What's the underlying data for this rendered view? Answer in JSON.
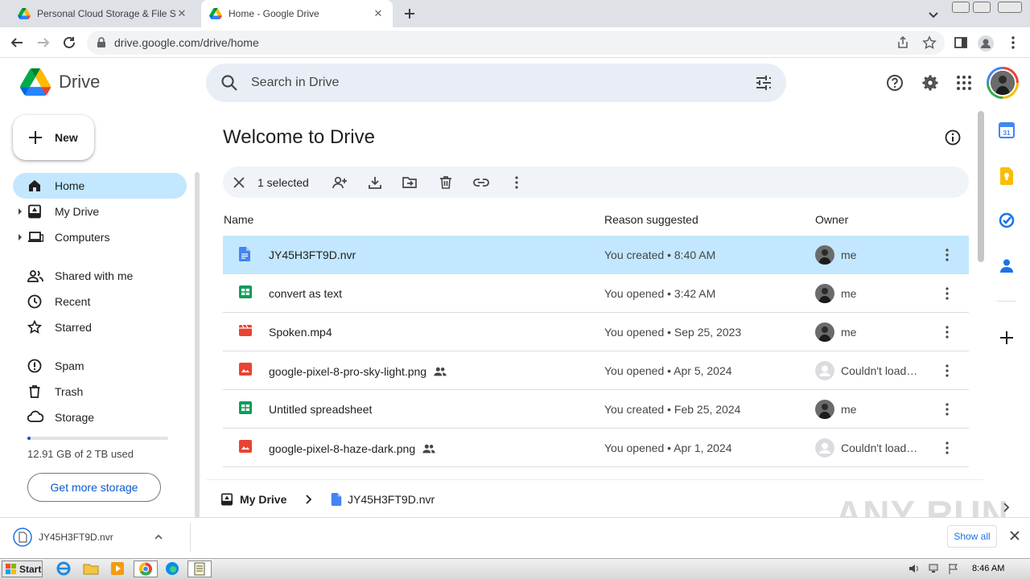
{
  "browser": {
    "tabs": [
      {
        "title": "Personal Cloud Storage & File Sharing",
        "active": false
      },
      {
        "title": "Home - Google Drive",
        "active": true
      }
    ],
    "url": "drive.google.com/drive/home"
  },
  "header": {
    "app_name": "Drive",
    "search_placeholder": "Search in Drive"
  },
  "sidebar": {
    "new_label": "New",
    "items": [
      {
        "label": "Home",
        "icon": "home-icon",
        "active": true
      },
      {
        "label": "My Drive",
        "icon": "my-drive-icon",
        "expandable": true
      },
      {
        "label": "Computers",
        "icon": "computers-icon",
        "expandable": true
      },
      {
        "label": "Shared with me",
        "icon": "people-icon"
      },
      {
        "label": "Recent",
        "icon": "clock-icon"
      },
      {
        "label": "Starred",
        "icon": "star-icon"
      },
      {
        "label": "Spam",
        "icon": "spam-icon"
      },
      {
        "label": "Trash",
        "icon": "trash-icon"
      },
      {
        "label": "Storage",
        "icon": "cloud-icon"
      }
    ],
    "storage_used_fraction": 0.0065,
    "storage_text": "12.91 GB of 2 TB used",
    "get_more_label": "Get more storage"
  },
  "main": {
    "title": "Welcome to Drive",
    "selection": {
      "count_text": "1 selected"
    },
    "columns": {
      "name": "Name",
      "reason": "Reason suggested",
      "owner": "Owner"
    },
    "rows": [
      {
        "name": "JY45H3FT9D.nvr",
        "type": "doc",
        "shared": false,
        "reason": "You created • 8:40 AM",
        "owner": "me",
        "selected": true
      },
      {
        "name": "convert as text",
        "type": "sheet",
        "shared": false,
        "reason": "You opened • 3:42 AM",
        "owner": "me"
      },
      {
        "name": "Spoken.mp4",
        "type": "video",
        "shared": false,
        "reason": "You opened • Sep 25, 2023",
        "owner": "me"
      },
      {
        "name": "google-pixel-8-pro-sky-light.png",
        "type": "image",
        "shared": true,
        "reason": "You opened • Apr 5, 2024",
        "owner": "Couldn't load…"
      },
      {
        "name": "Untitled spreadsheet",
        "type": "sheet",
        "shared": false,
        "reason": "You created • Feb 25, 2024",
        "owner": "me"
      },
      {
        "name": "google-pixel-8-haze-dark.png",
        "type": "image",
        "shared": true,
        "reason": "You opened • Apr 1, 2024",
        "owner": "Couldn't load…"
      }
    ]
  },
  "breadcrumb": {
    "root": "My Drive",
    "file": "JY45H3FT9D.nvr"
  },
  "downloads": {
    "file": "JY45H3FT9D.nvr",
    "show_all": "Show all"
  },
  "taskbar": {
    "start": "Start",
    "time": "8:46 AM"
  },
  "watermark": "ANY RUN"
}
